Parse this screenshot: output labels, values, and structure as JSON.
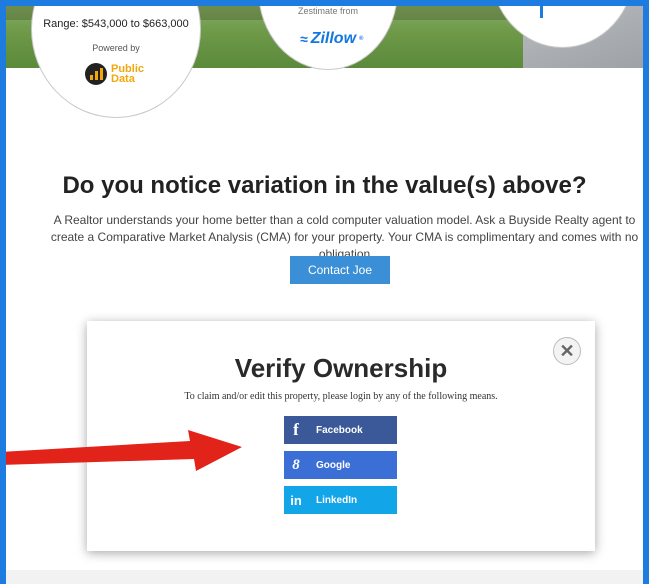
{
  "valuation": {
    "range": "Range: $543,000 to $663,000",
    "powered_by": "Powered by",
    "publicdata_line1": "Public",
    "publicdata_line2": "Data",
    "zestimate_from": "Zestimate from",
    "zillow": "Zillow",
    "zillow_tm": "®"
  },
  "variation": {
    "headline": "Do you notice variation in the value(s) above?",
    "description": "A Realtor understands your home better than a cold computer valuation model. Ask a Buyside Realty agent to create a Comparative Market Analysis (CMA) for your property. Your CMA is complimentary and comes with no obligation",
    "contact_label": "Contact Joe"
  },
  "modal": {
    "title": "Verify Ownership",
    "subtitle": "To claim and/or edit this property, please login by any of the following means.",
    "close_glyph": "✕",
    "buttons": [
      {
        "glyph": "f",
        "label": "Facebook",
        "color": "#3b5998"
      },
      {
        "glyph": "8",
        "label": "Google",
        "color": "#3b6fd6"
      },
      {
        "glyph": "in",
        "label": "LinkedIn",
        "color": "#12a5e8"
      }
    ]
  },
  "colors": {
    "accent_border": "#1e7be0",
    "contact_button": "#3a8fd6",
    "arrow": "#e2231a"
  }
}
